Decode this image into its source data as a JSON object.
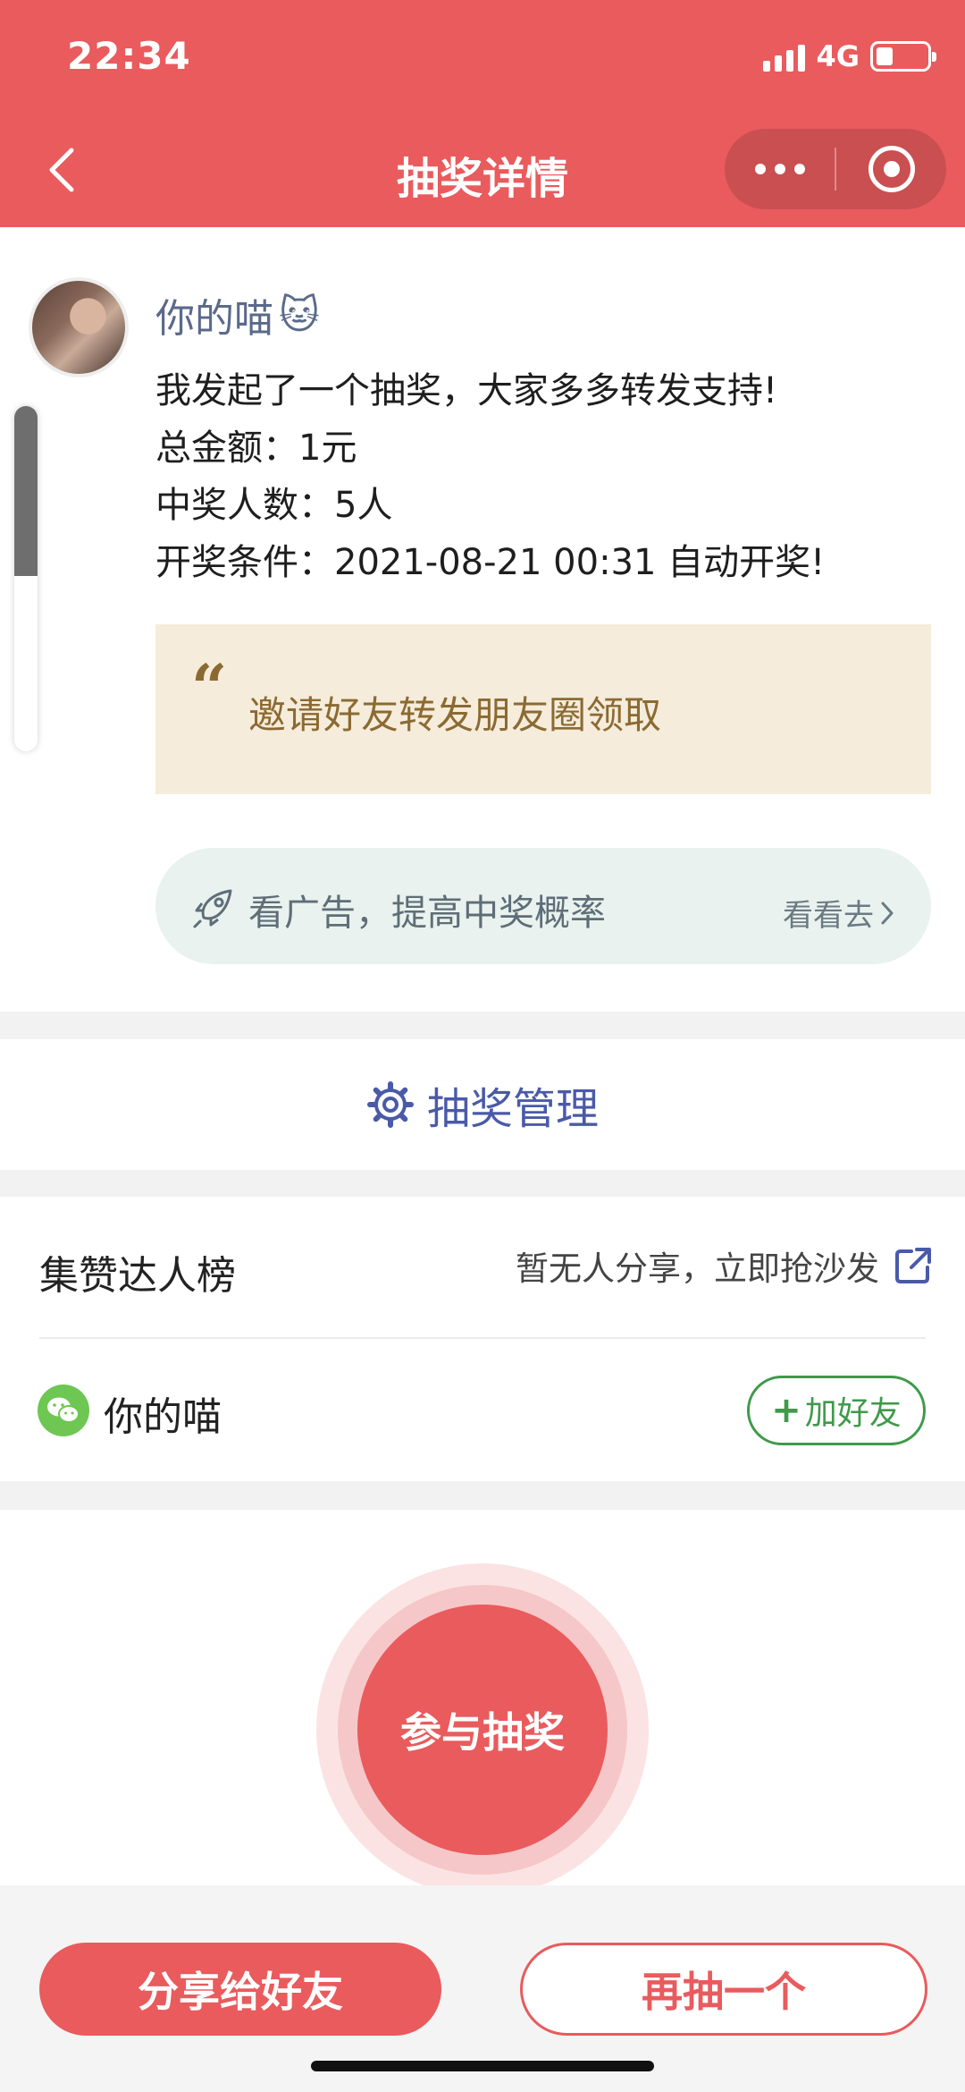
{
  "status_bar": {
    "time": "22:34",
    "network": "4G",
    "battery_percent": 34
  },
  "nav": {
    "title": "抽奖详情"
  },
  "post": {
    "author": "你的喵",
    "author_emoji": "🐱",
    "lines": [
      "我发起了一个抽奖，大家多多转发支持!",
      "总金额：1元",
      "中奖人数：5人",
      "开奖条件：2021-08-21 00:31 自动开奖!"
    ],
    "quote": "邀请好友转发朋友圈领取",
    "ad": {
      "text": "看广告，提高中奖概率",
      "link": "看看去"
    }
  },
  "manage": {
    "label": "抽奖管理"
  },
  "leaderboard": {
    "title": "集赞达人榜",
    "share_text": "暂无人分享，立即抢沙发",
    "user": "你的喵",
    "add_friend": "加好友"
  },
  "join": {
    "label": "参与抽奖"
  },
  "bottom": {
    "share_label": "分享给好友",
    "again_label": "再抽一个"
  },
  "colors": {
    "primary": "#e95b5d",
    "link_blue": "#4a5aa8",
    "quote_text": "#8b6a32",
    "green": "#3f9a4a"
  }
}
